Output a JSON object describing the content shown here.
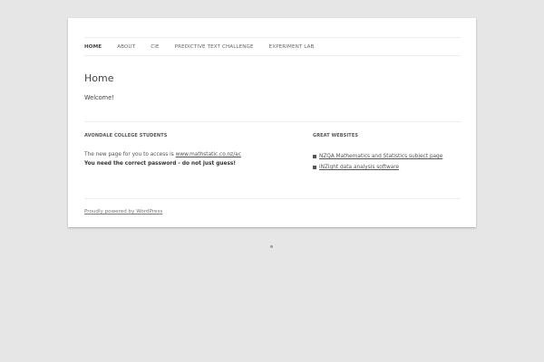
{
  "nav": {
    "items": [
      {
        "label": "HOME",
        "current": true
      },
      {
        "label": "ABOUT",
        "current": false
      },
      {
        "label": "CIE",
        "current": false
      },
      {
        "label": "PREDICTIVE TEXT CHALLENGE",
        "current": false
      },
      {
        "label": "EXPERIMENT LAB",
        "current": false
      }
    ]
  },
  "entry": {
    "title": "Home",
    "content": "Welcome!"
  },
  "widgets": {
    "left": {
      "title": "AVONDALE COLLEGE STUDENTS",
      "text_before_link": "The new page for you to access is ",
      "link_text": "www.mathstatic.co.nz/ac",
      "bold_text": "You need the correct password - do not just guess!"
    },
    "right": {
      "title": "GREAT WEBSITES",
      "links": [
        "NZQA Mathematics and Statistics subject page",
        "iNZight data analysis software"
      ]
    }
  },
  "footer": {
    "credit": "Proudly powered by WordPress"
  }
}
